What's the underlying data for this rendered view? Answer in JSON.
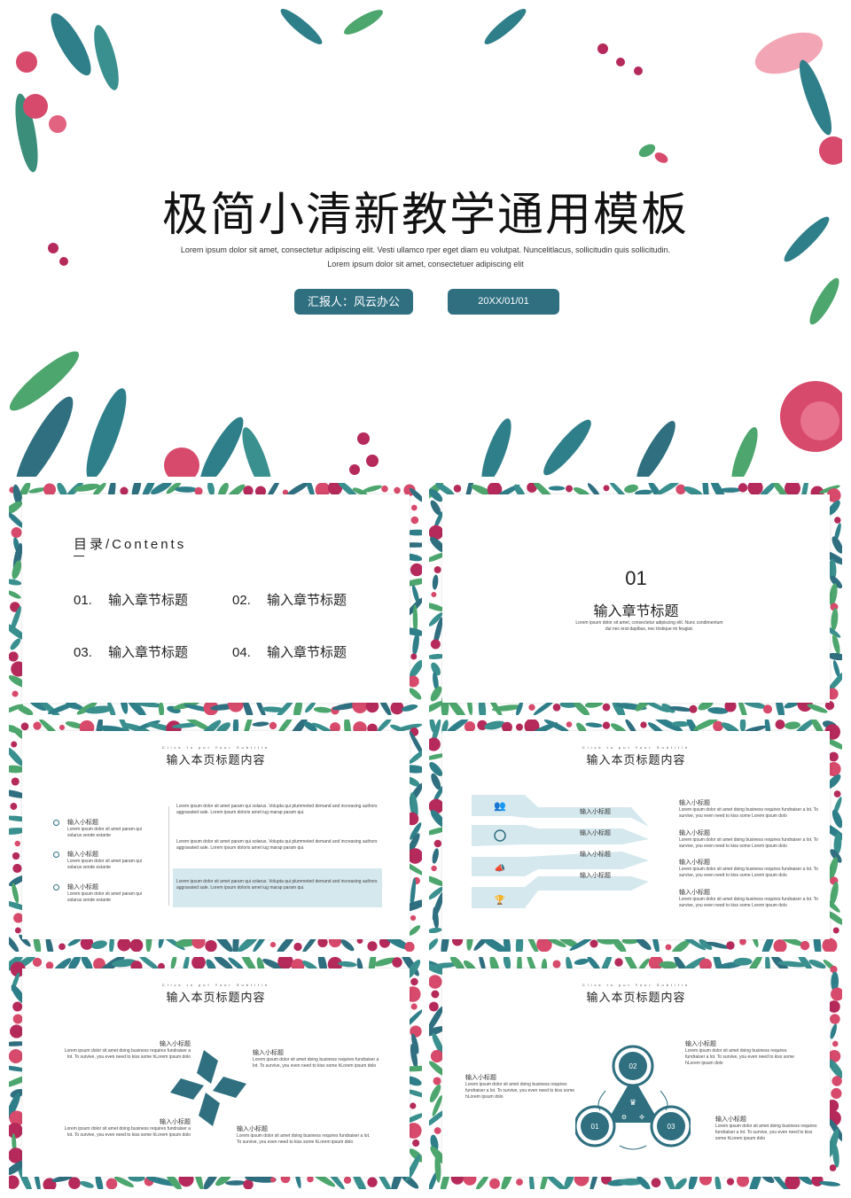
{
  "colors": {
    "teal": "#2f6f80",
    "light_blue": "#d5e8ee",
    "pink": "#d74a6b",
    "green": "#4da66d"
  },
  "cover": {
    "title": "极简小清新教学通用模板",
    "lorem": "Lorem ipsum dolor sit amet, consectetur adipiscing elit. Vesti ullamco rper eget diam eu volutpat. Nuncelitlacus,  sollicitudin quis sollicitudin. Lorem ipsum dolor sit amet, consectetuer adipiscing elit",
    "reporter": "汇报人：风云办公",
    "date": "20XX/01/01"
  },
  "toc": {
    "title": "目录/Contents",
    "items": [
      {
        "num": "01.",
        "label": "输入章节标题"
      },
      {
        "num": "02.",
        "label": "输入章节标题"
      },
      {
        "num": "03.",
        "label": "输入章节标题"
      },
      {
        "num": "04.",
        "label": "输入章节标题"
      }
    ]
  },
  "section": {
    "num": "01",
    "title": "输入章节标题",
    "desc": "Lorem ipsum dolor sit amet, consectetur adipiscing elit. Nunc condimentum dui nec erat dapibus, nec tristique mi feugiat."
  },
  "page_title": "输入本页标题内容",
  "page_subtitle": "Click to put Your Subtitle",
  "subheading": "输入小标题",
  "slide3": {
    "bullets": [
      {
        "title": "输入小标题",
        "text": "Lorem ipsum dolor sit amet param qui solarus sende estante"
      },
      {
        "title": "输入小标题",
        "text": "Lorem ipsum dolor sit amet param qui solarus sende estante"
      },
      {
        "title": "输入小标题",
        "text": "Lorem ipsum dolor sit amet param qui solarus sende estante"
      }
    ],
    "paragraphs": [
      "Lorem ipsum dolor sit amet param qui solarus. Volupta qui plummeted demand and increasing authors aggravated sale. Lorem ipsum doloris amet iug marap param qui.",
      "Lorem ipsum dolor sit amet param qui solarus. Volupta qui plummeted demand and increasing authors aggravated sale. Lorem ipsum doloris amet iug marap param qui.",
      "Lorem ipsum dolor sit amet param qui solarus. Volupta qui plummeted demand and increasing authors aggravated sale. Lorem ipsum doloris amet iug marap param qui."
    ]
  },
  "slide4": {
    "arrows": [
      "输入小标题",
      "输入小标题",
      "输入小标题",
      "输入小标题"
    ],
    "right": [
      {
        "title": "输入小标题",
        "text": "Lorem ipsum dolor sit amet doing business requires fundraiser a lot. To survive, you even need to kiss some Lorem ipsum dolo"
      },
      {
        "title": "输入小标题",
        "text": "Lorem ipsum dolor sit amet doing business requires fundraiser a lot. To survive, you even need to kiss some Lorem ipsum dolo"
      },
      {
        "title": "输入小标题",
        "text": "Lorem ipsum dolor sit amet doing business requires fundraiser a lot. To survive, you even need to kiss some Lorem ipsum dolo"
      },
      {
        "title": "输入小标题",
        "text": "Lorem ipsum dolor sit amet doing business requires fundraiser a lot. To survive, you even need to kiss some Lorem ipsum dolo"
      }
    ]
  },
  "slide5": {
    "blocks": [
      {
        "title": "输入小标题",
        "text": "Lorem ipsum dolor sit amet doing business requires fundraiser a lot. To survive, you even need to kiss some hLorem ipsum dolo"
      },
      {
        "title": "输入小标题",
        "text": "Lorem ipsum dolor sit amet doing business requires fundraiser a lot. To survive, you even need to kiss some hLorem ipsum dolo"
      },
      {
        "title": "输入小标题",
        "text": "Lorem ipsum dolor sit amet doing business requires fundraiser a lot. To survive, you even need to kiss some hLorem ipsum dolo"
      },
      {
        "title": "输入小标题",
        "text": "Lorem ipsum dolor sit amet doing business requires fundraiser a lot. To survive, you even need to kiss some hLorem ipsum dolo"
      }
    ]
  },
  "slide6": {
    "nums": [
      "02",
      "01",
      "03"
    ],
    "blocks": [
      {
        "title": "输入小标题",
        "text": "Lorem ipsum dolor sit amet doing business requires fundraiser a lot. To survive, you even need to kiss some hLorem ipsum dolo"
      },
      {
        "title": "输入小标题",
        "text": "Lorem ipsum dolor sit amet doing business requires fundraiser a lot. To survive, you even need to kiss some hLorem ipsum dolo"
      },
      {
        "title": "输入小标题",
        "text": "Lorem ipsum dolor sit amet doing business requires fundraiser a lot. To survive, you even need to kiss some hLorem ipsum dolo"
      }
    ]
  }
}
